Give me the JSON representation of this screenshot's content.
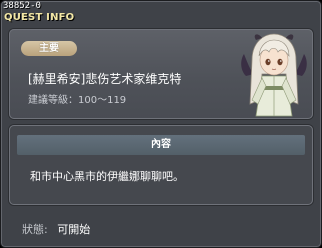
{
  "window": {
    "quest_id": "38852-0",
    "title": "QUEST INFO"
  },
  "info": {
    "badge_label": "主要",
    "quest_name": "[赫里希安]悲伤艺术家维克特",
    "level_label": "建議等級：100～119"
  },
  "content": {
    "header_label": "內容",
    "text": "和市中心黑市的伊繼娜聊聊吧。"
  },
  "status": {
    "label": "狀態:",
    "value": "可開始"
  },
  "colors": {
    "title": "#f4e8a6",
    "badge": "#c8b48f",
    "panel": "#4f5259",
    "content_header": "#5b6872"
  },
  "icons": {
    "npc_portrait": "white-haired-girl-npc-portrait"
  }
}
